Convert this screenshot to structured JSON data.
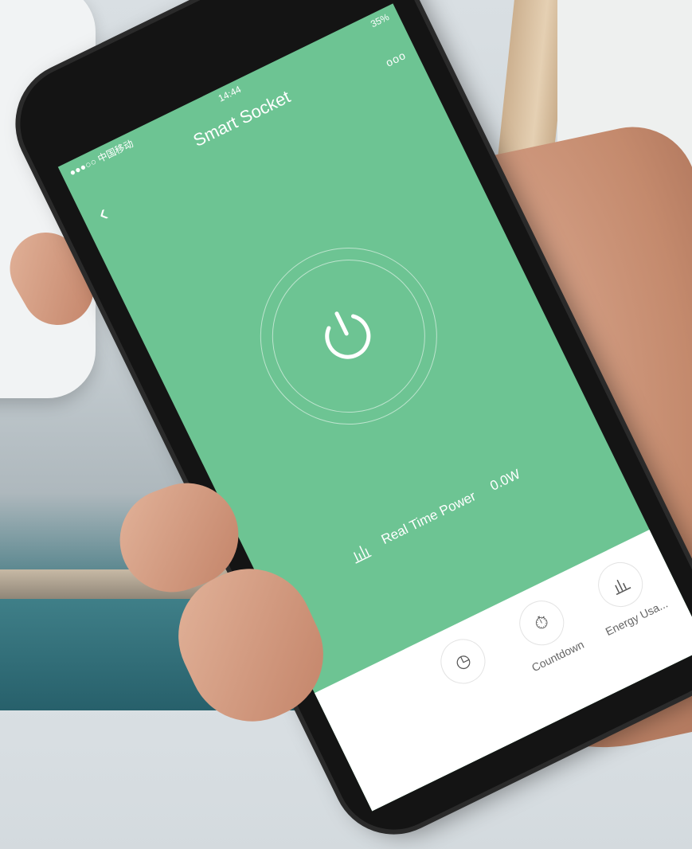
{
  "status_bar": {
    "carrier": "●●●○○ 中国移动",
    "time": "14:44",
    "battery": "35%"
  },
  "header": {
    "title": "Smart Socket",
    "more": "ooo"
  },
  "power": {
    "label": "Real Time Power",
    "value": "0.0W"
  },
  "toolbar": {
    "items": [
      {
        "label": "",
        "icon": "clock-icon"
      },
      {
        "label": "Countdown",
        "icon": "stopwatch-icon"
      },
      {
        "label": "Energy Usa...",
        "icon": "bar-chart-icon"
      }
    ]
  },
  "colors": {
    "screen_green": "#6dc493",
    "toolbar_bg": "#ffffff"
  }
}
